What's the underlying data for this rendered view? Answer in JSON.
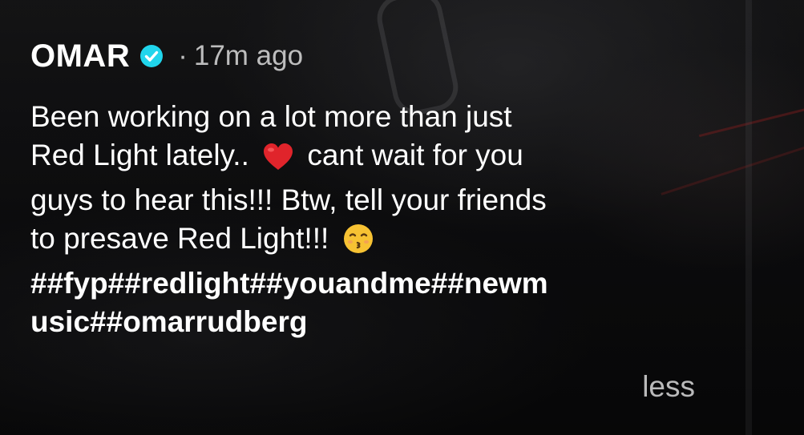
{
  "post": {
    "username": "OMAR",
    "separator": "·",
    "time_ago": "17m ago",
    "verified": true,
    "verified_icon": "verified-badge-icon",
    "verified_color": "#20d5ec",
    "caption": {
      "line1": "Been working on a lot more than just",
      "line2a": "Red Light lately..",
      "emoji_heart": "red-heart-emoji",
      "line2b": "cant wait for you",
      "line3": "guys to hear this!!! Btw, tell your friends",
      "line4": "to presave Red Light!!!",
      "emoji_kiss": "kissing-face-emoji"
    },
    "hashtags": [
      "##fyp",
      "##redlight",
      "##youandme",
      "##newm",
      "usic",
      "##omarrudberg"
    ],
    "less_label": "less"
  }
}
